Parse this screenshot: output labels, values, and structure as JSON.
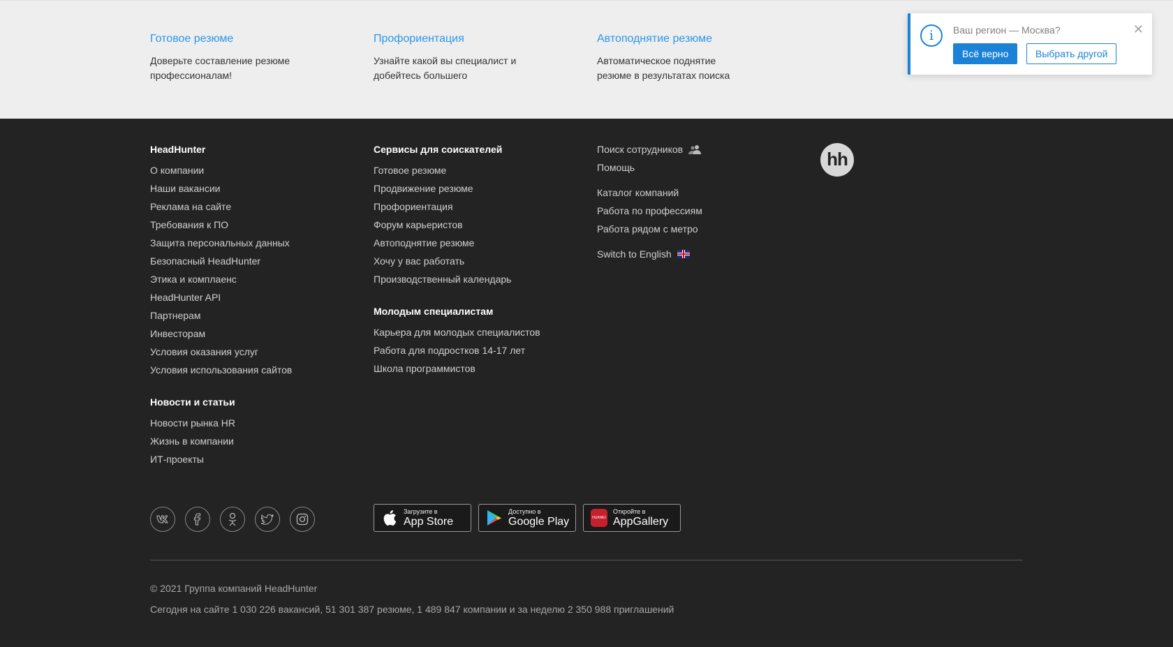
{
  "promo": [
    {
      "title": "Готовое резюме",
      "text_line1": "Доверьте составление резюме",
      "text_line2": "профессионалам!"
    },
    {
      "title": "Профориентация",
      "text_line1": "Узнайте какой вы специалист и",
      "text_line2": "добейтесь большего"
    },
    {
      "title": "Автоподнятие резюме",
      "text_line1": "Автоматическое поднятие",
      "text_line2": "резюме в результатах поиска"
    }
  ],
  "notice": {
    "text": "Ваш регион — Москва?",
    "confirm_label": "Всё верно",
    "change_label": "Выбрать другой",
    "close_glyph": "✕",
    "icon_glyph": "i"
  },
  "footer": {
    "col1": {
      "heading": "HeadHunter",
      "links": [
        "О компании",
        "Наши вакансии",
        "Реклама на сайте",
        "Требования к ПО",
        "Защита персональных данных",
        "Безопасный HeadHunter",
        "Этика и комплаенс",
        "HeadHunter API",
        "Партнерам",
        "Инвесторам",
        "Условия оказания услуг",
        "Условия использования сайтов"
      ],
      "heading2": "Новости и статьи",
      "links2": [
        "Новости рынка HR",
        "Жизнь в компании",
        "ИТ-проекты"
      ]
    },
    "col2": {
      "heading": "Сервисы для соискателей",
      "links": [
        "Готовое резюме",
        "Продвижение резюме",
        "Профориентация",
        "Форум карьеристов",
        "Автоподнятие резюме",
        "Хочу у вас работать",
        "Производственный календарь"
      ],
      "heading2": "Молодым специалистам",
      "links2": [
        "Карьера для молодых специалистов",
        "Работа для подростков 14-17 лет",
        "Школа программистов"
      ]
    },
    "col3": {
      "search_employees": "Поиск сотрудников",
      "help": "Помощь",
      "links": [
        "Каталог компаний",
        "Работа по профессиям",
        "Работа рядом с метро"
      ],
      "switch_lang": "Switch to English"
    },
    "logo_text": "hh"
  },
  "social": [
    "vk",
    "f",
    "ok",
    "tw",
    "ig"
  ],
  "stores": [
    {
      "small": "Загрузите в",
      "big": "App Store"
    },
    {
      "small": "Доступно в",
      "big": "Google Play"
    },
    {
      "small": "Откройте в",
      "big": "AppGallery",
      "badge": "HUAWEI"
    }
  ],
  "copyright": "© 2021 Группа компаний HeadHunter",
  "stats": "Сегодня на сайте 1 030 226 вакансий, 51 301 387 резюме, 1 489 847 компании и за неделю 2 350 988 приглашений",
  "colors": {
    "accent": "#1b82d8",
    "link": "#2c96e8",
    "footer_bg": "#232323",
    "promo_bg": "#eeeeee"
  }
}
